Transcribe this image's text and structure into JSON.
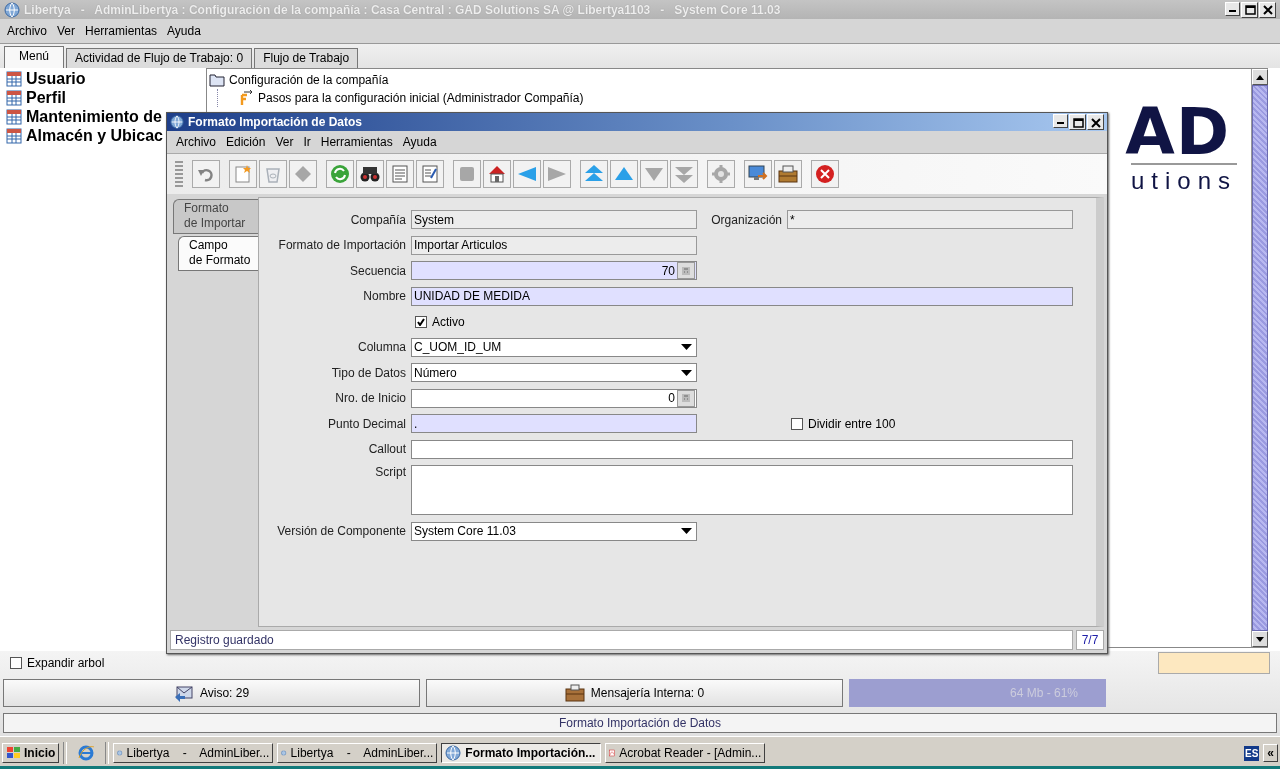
{
  "window": {
    "title": "Libertya   -   AdminLibertya : Configuración de la compañía : Casa Central : GAD Solutions SA @ Libertya1103   -   System Core 11.03"
  },
  "menu": [
    "Archivo",
    "Ver",
    "Herramientas",
    "Ayuda"
  ],
  "tabs": [
    {
      "label": "Menú",
      "selected": true
    },
    {
      "label": "Actividad de Flujo de Trabajo: 0",
      "selected": false
    },
    {
      "label": "Flujo de Trabajo",
      "selected": false
    }
  ],
  "favorites": [
    "Usuario",
    "Perfil",
    "Mantenimiento de",
    "Almacén y Ubicac"
  ],
  "tree": [
    {
      "label": "Configuración de la compañía",
      "kind": "folder",
      "children": [
        {
          "label": "Pasos para la configuración inicial (Administrador Compañía)",
          "kind": "workflow"
        }
      ]
    }
  ],
  "logo": {
    "letters": "AD",
    "subtitle": "utions"
  },
  "expand_tree": {
    "label": "Expandir arbol",
    "checked": false
  },
  "buttons": [
    {
      "label": "Aviso: 29",
      "kind": "alert"
    },
    {
      "label": "Mensajería Interna: 0",
      "kind": "messages"
    }
  ],
  "memory": "64 Mb - 61%",
  "status_bar": "Formato Importación de Datos",
  "dialog": {
    "title": "Formato Importación de Datos",
    "menu": [
      "Archivo",
      "Edición",
      "Ver",
      "Ir",
      "Herramientas",
      "Ayuda"
    ],
    "toolbar": [
      [
        {
          "kind": "undo",
          "disabled": true
        }
      ],
      [
        {
          "kind": "new",
          "disabled": false
        },
        {
          "kind": "delete",
          "disabled": true
        },
        {
          "kind": "save",
          "disabled": true
        }
      ],
      [
        {
          "kind": "refresh",
          "disabled": false
        },
        {
          "kind": "find",
          "disabled": false
        },
        {
          "kind": "report",
          "disabled": false
        },
        {
          "kind": "form",
          "disabled": false
        }
      ],
      [
        {
          "kind": "attachment",
          "disabled": true
        },
        {
          "kind": "home",
          "disabled": false
        },
        {
          "kind": "back",
          "disabled": false
        },
        {
          "kind": "forward",
          "disabled": true
        }
      ],
      [
        {
          "kind": "first",
          "disabled": false
        },
        {
          "kind": "previous",
          "disabled": false
        },
        {
          "kind": "next",
          "disabled": true
        },
        {
          "kind": "last",
          "disabled": true
        }
      ],
      [
        {
          "kind": "process",
          "disabled": true
        }
      ],
      [
        {
          "kind": "export",
          "disabled": false
        },
        {
          "kind": "archive",
          "disabled": false
        }
      ],
      [
        {
          "kind": "close",
          "disabled": false
        }
      ]
    ],
    "side_tabs": [
      {
        "label": "Formato\nde Importar",
        "selected": false
      },
      {
        "label": "Campo\nde Formato",
        "selected": true
      }
    ],
    "rows": [
      {
        "fields": [
          {
            "label": "Compañía",
            "kind": "text",
            "value": "System",
            "readonly": true,
            "mandatory": false
          },
          {
            "label": "Organización",
            "kind": "text",
            "value": "*",
            "readonly": true,
            "mandatory": false
          }
        ]
      },
      {
        "fields": [
          {
            "label": "Formato de Importación",
            "kind": "text",
            "value": "Importar Articulos",
            "readonly": true,
            "mandatory": false
          }
        ]
      },
      {
        "fields": [
          {
            "label": "Secuencia",
            "kind": "number",
            "value": "70",
            "readonly": false,
            "mandatory": true
          }
        ]
      },
      {
        "fields": [
          {
            "label": "Nombre",
            "kind": "text",
            "value": "UNIDAD DE MEDIDA",
            "readonly": false,
            "mandatory": true
          }
        ]
      },
      {
        "fields": [
          {
            "label": "Activo",
            "kind": "checkbox",
            "checked": true
          }
        ]
      },
      {
        "fields": [
          {
            "label": "Columna",
            "kind": "combo",
            "value": "C_UOM_ID_UM",
            "readonly": false,
            "mandatory": false
          }
        ]
      },
      {
        "fields": [
          {
            "label": "Tipo de Datos",
            "kind": "combo",
            "value": "Número",
            "readonly": false,
            "mandatory": false
          }
        ]
      },
      {
        "fields": [
          {
            "label": "Nro. de Inicio",
            "kind": "number",
            "value": "0",
            "readonly": false,
            "mandatory": false
          }
        ]
      },
      {
        "fields": [
          {
            "label": "Punto Decimal",
            "kind": "text",
            "value": ".",
            "readonly": false,
            "mandatory": true
          },
          {
            "label": "Dividir entre 100",
            "kind": "checkbox",
            "checked": false
          }
        ]
      },
      {
        "fields": [
          {
            "label": "Callout",
            "kind": "text",
            "readonly": false,
            "mandatory": false
          }
        ]
      },
      {
        "fields": [
          {
            "label": "Script",
            "kind": "textarea",
            "readonly": false,
            "mandatory": false
          }
        ]
      },
      {
        "fields": [
          {
            "label": "Versión de Componente",
            "kind": "combo",
            "value": "System Core 11.03",
            "readonly": false,
            "mandatory": false
          }
        ]
      }
    ],
    "status": "Registro guardado",
    "record": "7/7"
  },
  "taskbar": {
    "start": "Inicio",
    "tasks": [
      {
        "label": "Libertya    -    AdminLiber...",
        "kind": "app",
        "selected": false
      },
      {
        "label": "Libertya    -    AdminLiber...",
        "kind": "app",
        "selected": false
      },
      {
        "label": "Formato Importación...",
        "kind": "app",
        "selected": true
      },
      {
        "label": "Acrobat Reader - [Admin...",
        "kind": "pdf",
        "selected": false
      }
    ],
    "language": "ES",
    "tray_toggle": "«"
  }
}
